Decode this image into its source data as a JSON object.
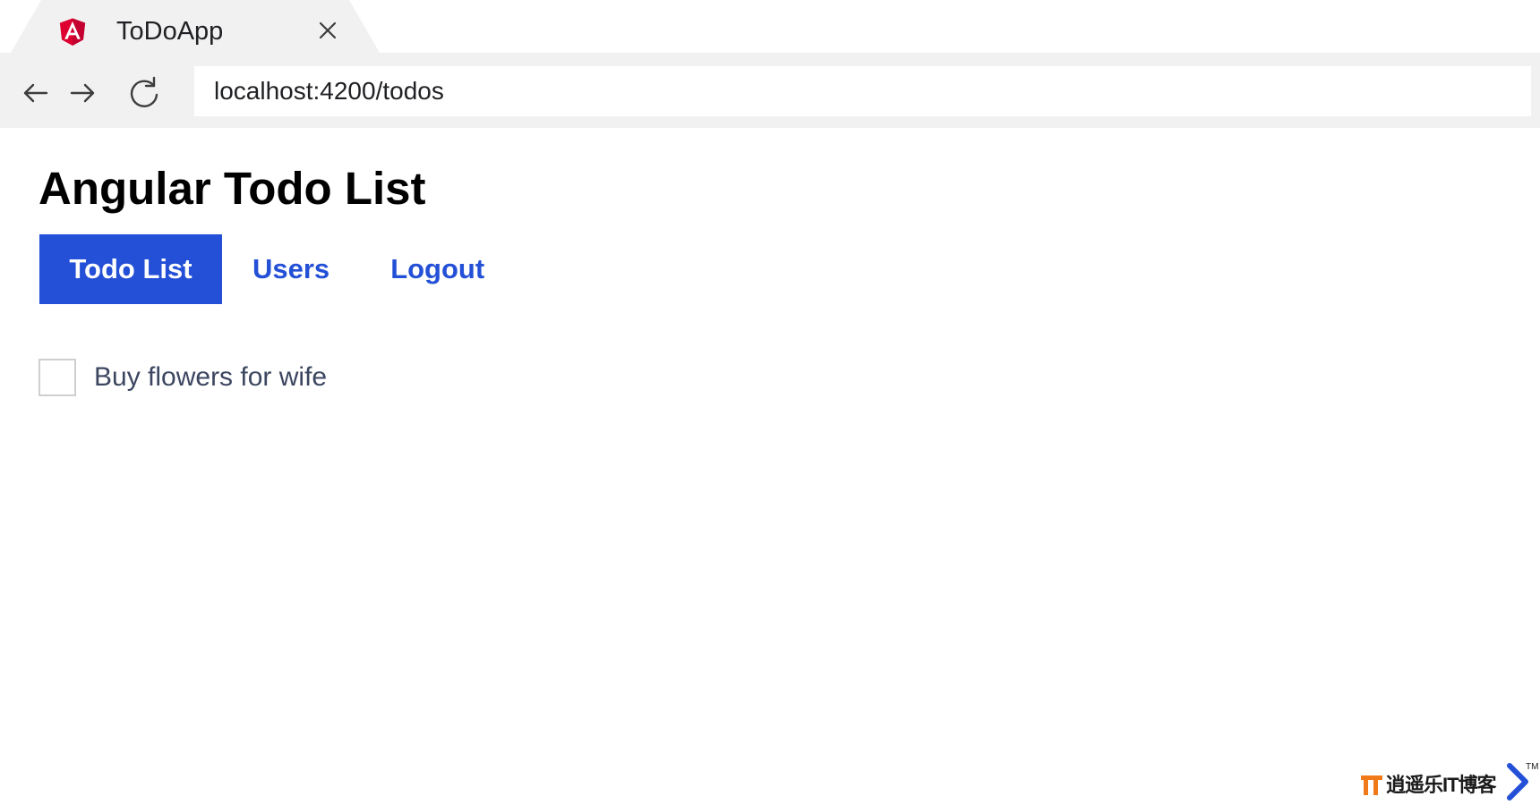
{
  "browser": {
    "tab": {
      "title": "ToDoApp",
      "favicon": "angular-logo-icon",
      "close_icon": "close-icon"
    },
    "toolbar": {
      "back_icon": "arrow-left-icon",
      "forward_icon": "arrow-right-icon",
      "reload_icon": "reload-icon",
      "address": "localhost:4200/todos"
    }
  },
  "app": {
    "title": "Angular Todo List",
    "nav": {
      "items": [
        {
          "label": "Todo List",
          "active": true
        },
        {
          "label": "Users",
          "active": false
        },
        {
          "label": "Logout",
          "active": false
        }
      ]
    },
    "todos": [
      {
        "text": "Buy flowers for wife",
        "done": false
      }
    ]
  },
  "watermark": {
    "text": "逍遥乐IT博客",
    "highlight": "IT",
    "tm": "TM"
  },
  "colors": {
    "accent": "#2350d6",
    "chrome_bg": "#f1f1f1",
    "angular_red": "#dd0031",
    "todo_text": "#3c4660",
    "watermark_orange": "#f07a1a"
  }
}
